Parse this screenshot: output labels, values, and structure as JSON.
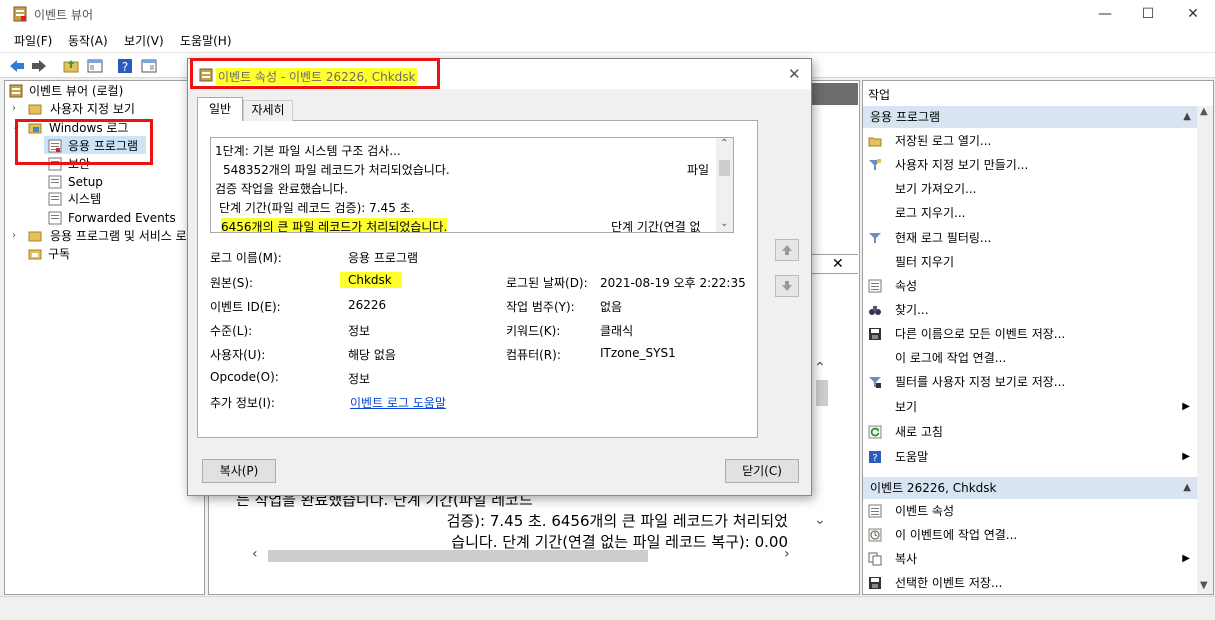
{
  "window": {
    "title": "이벤트 뷰어",
    "minimize": "—",
    "maximize": "☐",
    "close": "✕"
  },
  "menu": [
    "파일(F)",
    "동작(A)",
    "보기(V)",
    "도움말(H)"
  ],
  "tree": {
    "root": "이벤트 뷰어 (로컬)",
    "custom_views": "사용자 지정 보기",
    "windows_logs": "Windows 로그",
    "application": "응용 프로그램",
    "security": "보안",
    "setup": "Setup",
    "system": "시스템",
    "forwarded": "Forwarded Events",
    "app_service_logs": "응용 프로그램 및 서비스 로",
    "subscriptions": "구독"
  },
  "middle_preview": [
    "는 작업을 완료했습니다. 단계 기간(파일 레코드",
    "검증): 7.45 초. 6456개의 큰 파일 레코드가 처리되었",
    "습니다. 단계 기간(연결 없는 파일 레코드 복구): 0.00"
  ],
  "dialog": {
    "title": "이벤트 속성 - 이벤트 26226, Chkdsk",
    "close": "✕",
    "tabs": {
      "general": "일반",
      "detail": "자세히"
    },
    "description": [
      "1단계: 기본 파일 시스템 구조 검사...",
      "548352개의 파일 레코드가 처리되었습니다.",
      "검증 작업을 완료했습니다.",
      "단계 기간(파일 레코드 검증): 7.45 초.",
      "6456개의 큰 파일 레코드가 처리되었습니다."
    ],
    "description_right": {
      "line2": "파일",
      "line5": "단계 기간(연결 없"
    },
    "fields": {
      "log_name_label": "로그 이름(M):",
      "log_name": "응용 프로그램",
      "source_label": "원본(S):",
      "source": "Chkdsk",
      "logged_label": "로그된 날짜(D):",
      "logged": "2021-08-19 오후 2:22:35",
      "event_id_label": "이벤트 ID(E):",
      "event_id": "26226",
      "task_label": "작업 범주(Y):",
      "task": "없음",
      "level_label": "수준(L):",
      "level": "정보",
      "keywords_label": "키워드(K):",
      "keywords": "클래식",
      "user_label": "사용자(U):",
      "user": "해당 없음",
      "computer_label": "컴퓨터(R):",
      "computer": "ITzone_SYS1",
      "opcode_label": "Opcode(O):",
      "opcode": "정보",
      "more_info_label": "추가 정보(I):",
      "more_info": "이벤트 로그 도움말"
    },
    "buttons": {
      "copy": "복사(P)",
      "close": "닫기(C)"
    }
  },
  "actions": {
    "header": "작업",
    "section1": "응용 프로그램",
    "items1": [
      "저장된 로그 열기...",
      "사용자 지정 보기 만들기...",
      "보기 가져오기...",
      "로그 지우기...",
      "현재 로그 필터링...",
      "필터 지우기",
      "속성",
      "찾기...",
      "다른 이름으로 모든 이벤트 저장...",
      "이 로그에 작업 연결...",
      "필터를 사용자 지정 보기로 저장...",
      "보기",
      "새로 고침",
      "도움말"
    ],
    "section2": "이벤트 26226, Chkdsk",
    "items2": [
      "이벤트 속성",
      "이 이벤트에 작업 연결...",
      "복사",
      "선택한 이벤트 저장..."
    ]
  },
  "colors": {
    "highlight": "#ffff2e",
    "red_box": "#ee1111",
    "section_header": "#d8e4f2",
    "link": "#0645d8"
  }
}
